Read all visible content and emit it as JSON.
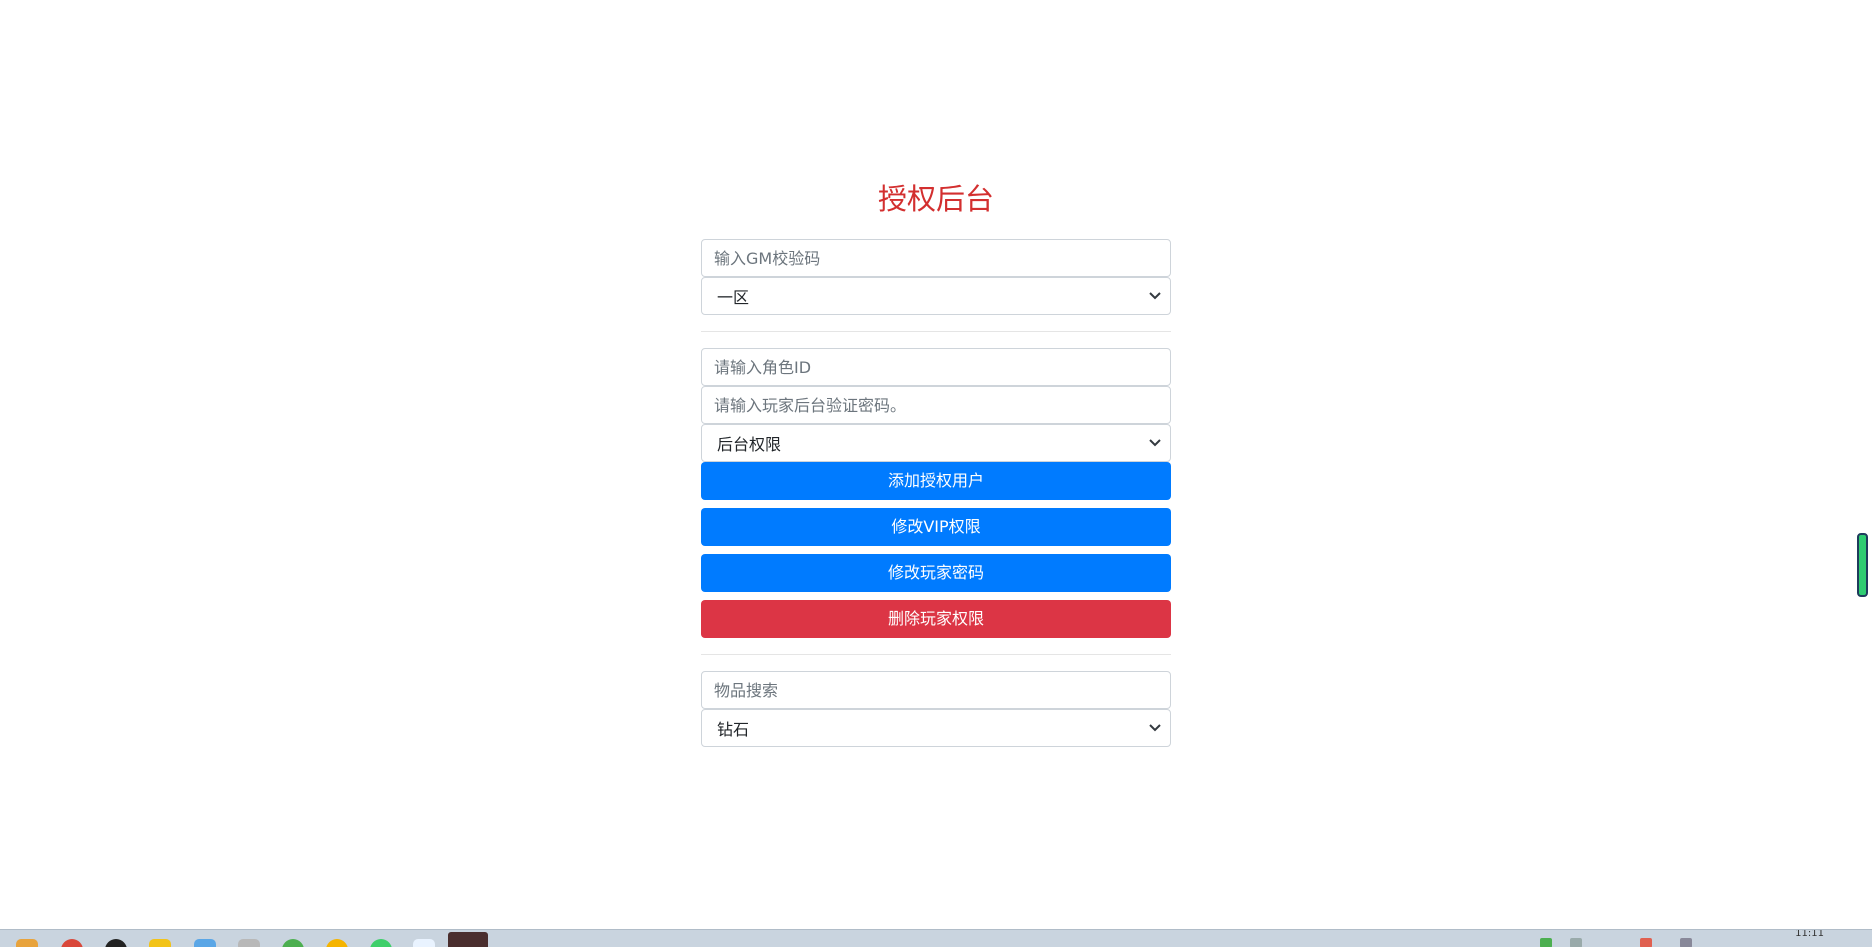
{
  "title": "授权后台",
  "gm_code": {
    "value": "",
    "placeholder": "输入GM校验码"
  },
  "server_select": {
    "selected": "一区"
  },
  "role_id": {
    "value": "",
    "placeholder": "请输入角色ID"
  },
  "player_password": {
    "value": "",
    "placeholder": "请输入玩家后台验证密码。"
  },
  "permission_select": {
    "selected": "后台权限"
  },
  "buttons": {
    "add_user": "添加授权用户",
    "modify_vip": "修改VIP权限",
    "modify_password": "修改玩家密码",
    "delete_permission": "删除玩家权限"
  },
  "item_search": {
    "value": "",
    "placeholder": "物品搜索"
  },
  "item_select": {
    "selected": "钻石"
  },
  "taskbar": {
    "clock": "11:11"
  },
  "colors": {
    "title": "#d32f2f",
    "primary_button": "#007bff",
    "danger_button": "#dc3545"
  }
}
